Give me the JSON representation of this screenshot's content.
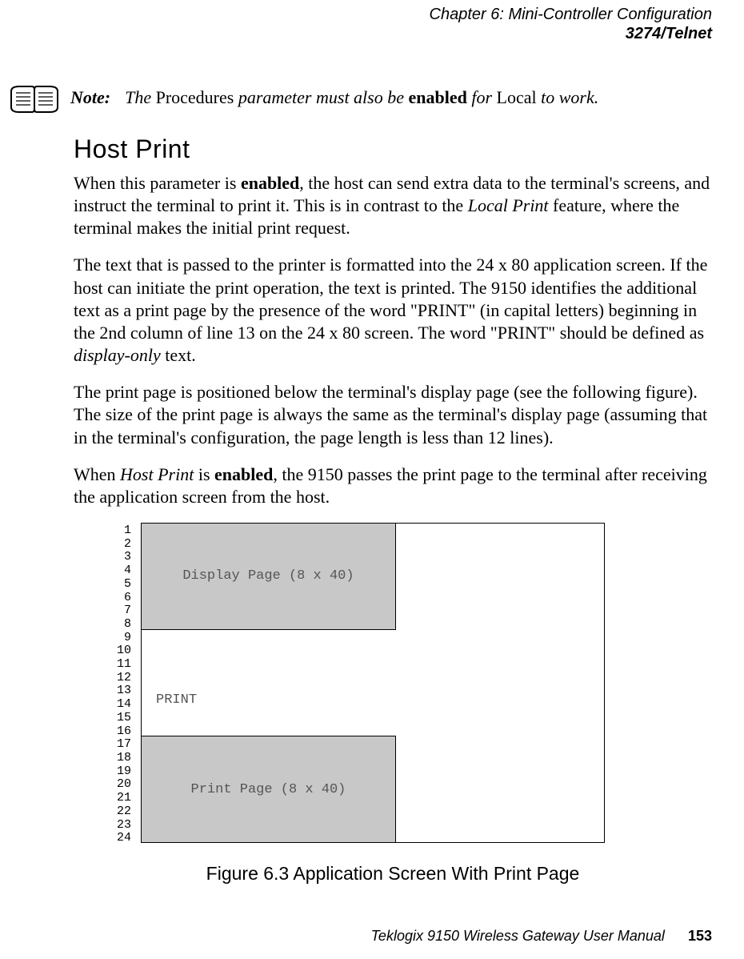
{
  "header": {
    "chapter": "Chapter 6:  Mini-Controller Configuration",
    "section": "3274/Telnet"
  },
  "note": {
    "label": "Note:",
    "text_1": "The ",
    "text_2": "Procedures",
    "text_3": " parameter must also be ",
    "text_4": "enabled",
    "text_5": " for ",
    "text_6": "Local",
    "text_7": " to work."
  },
  "h2": "Host Print",
  "p1": {
    "a": "When this parameter is ",
    "b": "enabled",
    "c": ", the host can send extra data to the terminal's screens, and instruct the terminal to print it. This is in contrast to the ",
    "d": "Local Print",
    "e": " feature, where the terminal makes the initial print request."
  },
  "p2": {
    "a": "The text that is passed to the printer is formatted into the 24 x 80 application screen. If the host can initiate the print operation, the text is printed. The 9150 identifies the additional text as a print page by the presence of the word \"PRINT\" (in capital letters) beginning in the 2nd column of line 13 on the 24 x 80 screen. The word \"PRINT\" should be defined as ",
    "b": "display-only",
    "c": " text."
  },
  "p3": "The print page is positioned below the terminal's display page (see the following figure). The size of the print page is always the same as the terminal's display page (assuming that in the terminal's configuration, the page length is less than 12 lines).",
  "p4": {
    "a": "When ",
    "b": "Host Print",
    "c": " is ",
    "d": "enabled",
    "e": ", the 9150 passes the print page to the terminal after receiving the application screen from the host."
  },
  "figure": {
    "line_numbers": " 1\n 2\n 3\n 4\n 5\n 6\n 7\n 8\n 9\n10\n11\n12\n13\n14\n15\n16\n17\n18\n19\n20\n21\n22\n23\n24",
    "display_label": "Display Page (8 x 40)",
    "print_word": "PRINT",
    "print_label": "Print Page (8 x 40)",
    "caption": "Figure 6.3 Application Screen With Print Page"
  },
  "footer": {
    "manual": "Teklogix 9150 Wireless Gateway User Manual",
    "page": "153"
  },
  "chart_data": {
    "type": "diagram",
    "description": "24-row application screen layout",
    "rows": 24,
    "regions": [
      {
        "name": "Display Page",
        "rows": "1-8",
        "size": "8 x 40"
      },
      {
        "name": "PRINT keyword",
        "row": 13,
        "column_start": 2
      },
      {
        "name": "Print Page",
        "rows": "17-24",
        "size": "8 x 40"
      }
    ]
  }
}
